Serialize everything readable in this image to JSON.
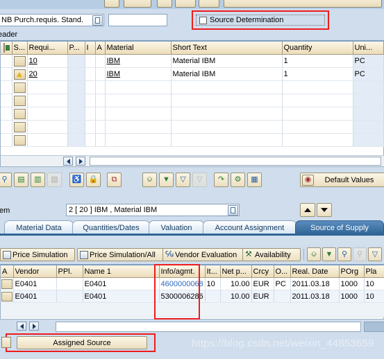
{
  "header": {
    "document_type": "NB Purch.requis. Stand.",
    "document_number": "",
    "source_determination_label": "Source Determination",
    "source_determination_checked": false,
    "section_label": "eader"
  },
  "item_grid": {
    "columns": [
      "",
      "S...",
      "Requi...",
      "P...",
      "I",
      "A",
      "Material",
      "Short Text",
      "Quantity",
      "Uni..."
    ],
    "rows": [
      {
        "status": "",
        "requisitioner": "10",
        "p": "",
        "i": "",
        "a": "",
        "material": "IBM",
        "short_text": "Material   IBM",
        "quantity": "1",
        "unit": "PC"
      },
      {
        "status": "warning",
        "requisitioner": "20",
        "p": "",
        "i": "",
        "a": "",
        "material": "IBM",
        "short_text": "Material   IBM",
        "quantity": "1",
        "unit": "PC"
      }
    ],
    "empty_rows": 5
  },
  "mid_toolbar": {
    "buttons": [
      {
        "name": "check-icon",
        "glyph": "⌕"
      },
      {
        "name": "save-icon",
        "glyph": "▤"
      },
      {
        "name": "overview-icon",
        "glyph": "▥"
      },
      {
        "name": "document-icon",
        "glyph": "▧",
        "disabled": true
      },
      {
        "name": "delete-icon",
        "glyph": "Ὕ1"
      },
      {
        "name": "lock-icon",
        "glyph": "⚿"
      },
      {
        "name": "copy-icon",
        "glyph": "⧉"
      },
      {
        "name": "print-icon",
        "glyph": "⎙"
      },
      {
        "name": "filter-set-icon",
        "glyph": "∇"
      },
      {
        "name": "filter-icon",
        "glyph": "▽"
      },
      {
        "name": "unfilter-icon",
        "glyph": "▽",
        "disabled": true
      },
      {
        "name": "personal-setting-icon",
        "glyph": "↱"
      },
      {
        "name": "config-icon",
        "glyph": "⚙"
      },
      {
        "name": "clipboard-icon",
        "glyph": "▦"
      }
    ],
    "default_values_label": "Default Values"
  },
  "item_selector": {
    "label": "tem",
    "value": "2 [ 20 ] IBM , Material   IBM",
    "prev_label": "▲",
    "next_label": "▼"
  },
  "tabs": [
    {
      "label": "Material Data",
      "active": false
    },
    {
      "label": "Quantities/Dates",
      "active": false
    },
    {
      "label": "Valuation",
      "active": false
    },
    {
      "label": "Account Assignment",
      "active": false
    },
    {
      "label": "Source of Supply",
      "active": true
    }
  ],
  "price_toolbar": {
    "buttons": [
      {
        "label": "Price Simulation",
        "icon": "calculator-icon"
      },
      {
        "label": "Price Simulation/All",
        "icon": "calculator-icon"
      },
      {
        "label": "Vendor Evaluation",
        "icon": "glasses-icon"
      },
      {
        "label": "Availability",
        "icon": "availability-icon"
      }
    ],
    "icons": [
      {
        "name": "print-icon",
        "glyph": "⎙"
      },
      {
        "name": "filter-set-icon",
        "glyph": "∇"
      },
      {
        "name": "find-icon",
        "glyph": "⌘"
      },
      {
        "name": "find-next-icon",
        "glyph": "⌘",
        "disabled": true
      },
      {
        "name": "filter-icon",
        "glyph": "▽"
      }
    ]
  },
  "vendor_grid": {
    "columns": [
      "A",
      "Vendor",
      "PPl.",
      "Name 1",
      "Info/agmt.",
      "It...",
      "Net p...",
      "Crcy",
      "O...",
      "Real. Date",
      "POrg",
      "Pla"
    ],
    "rows": [
      {
        "a": "",
        "vendor": "E0401",
        "ppl": "",
        "name1": "E0401",
        "info_agmt": "4600000068",
        "info_link": true,
        "item": "10",
        "net_price": "10.00",
        "currency": "EUR",
        "order_unit": "PC",
        "real_date": "2011.03.18",
        "porg": "1000",
        "plant": "10"
      },
      {
        "a": "",
        "vendor": "E0401",
        "ppl": "",
        "name1": "E0401",
        "info_agmt": "5300006286",
        "info_link": false,
        "item": "",
        "net_price": "10.00",
        "currency": "EUR",
        "order_unit": "",
        "real_date": "2011.03.18",
        "porg": "1000",
        "plant": "10"
      }
    ]
  },
  "footer": {
    "assigned_source_label": "Assigned Source",
    "watermark": "https://blog.csdn.net/weixin_44853659",
    "scroll_left": "◄",
    "scroll_right": "►"
  },
  "colors": {
    "highlight_red": "#ee1c1c",
    "tab_active": "#2f6596",
    "link_blue": "#2d6bbf",
    "button_beige": "#ecdfc0"
  }
}
